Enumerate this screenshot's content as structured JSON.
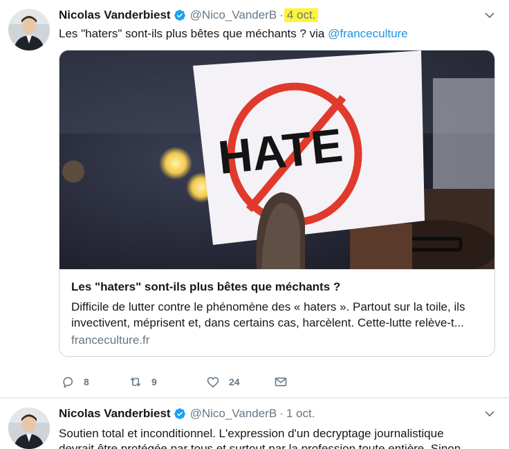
{
  "tweets": [
    {
      "author_name": "Nicolas Vanderbiest",
      "handle": "@Nico_VanderB",
      "separator": "·",
      "time": "4 oct.",
      "text_before": "Les \"haters\" sont-ils plus bêtes que méchants ? via ",
      "mention": "@franceculture",
      "card": {
        "title": "Les \"haters\" sont-ils plus bêtes que méchants ?",
        "description": "Difficile de lutter contre le phénomène des « haters ». Partout sur la toile, ils invectivent, méprisent et, dans certains cas, harcèlent. Cette-lutte relève-t...",
        "domain": "franceculture.fr",
        "image_sign_text": "HATE"
      },
      "actions": {
        "reply_count": "8",
        "retweet_count": "9",
        "like_count": "24"
      }
    },
    {
      "author_name": "Nicolas Vanderbiest",
      "handle": "@Nico_VanderB",
      "separator": "·",
      "time": "1 oct.",
      "text_line1": "Soutien total et inconditionnel. L'expression d'un decryptage journalistique",
      "text_line2": "devrait être protégée par tous et surtout par la profession toute entière. Sinon..."
    }
  ],
  "colors": {
    "link": "#1b95e0",
    "muted": "#657786",
    "verified": "#1da1f2",
    "highlight": "#fff33c"
  },
  "icons": [
    "verified-badge-icon",
    "chevron-down-icon",
    "reply-icon",
    "retweet-icon",
    "like-icon",
    "direct-message-icon"
  ]
}
